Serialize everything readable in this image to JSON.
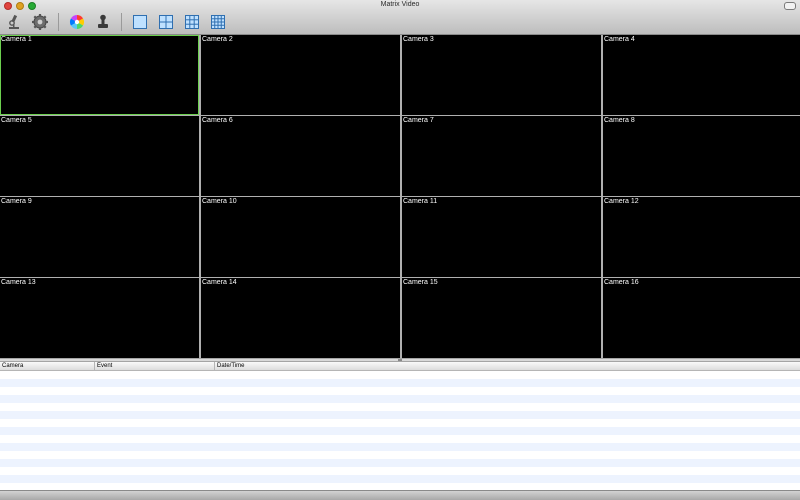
{
  "window": {
    "title": "Matrix Video"
  },
  "toolbar": {
    "items": [
      {
        "icon": "microscope-icon"
      },
      {
        "icon": "gear-icon"
      },
      {
        "icon": "color-wheel-icon"
      },
      {
        "icon": "stamp-icon"
      },
      {
        "icon": "layout-1x1-icon"
      },
      {
        "icon": "layout-2x2-icon"
      },
      {
        "icon": "layout-3x3-icon"
      },
      {
        "icon": "layout-4x4-icon"
      }
    ]
  },
  "cameras": [
    "Camera 1",
    "Camera 2",
    "Camera 3",
    "Camera 4",
    "Camera 5",
    "Camera 6",
    "Camera 7",
    "Camera 8",
    "Camera 9",
    "Camera 10",
    "Camera 11",
    "Camera 12",
    "Camera 13",
    "Camera 14",
    "Camera 15",
    "Camera 16"
  ],
  "selected_camera": "Camera 1",
  "events_table": {
    "columns": [
      "Camera",
      "Event",
      "Date/Time"
    ],
    "rows": []
  },
  "colors": {
    "selection": "#6cd04f",
    "row_stripe": "#edf3fe",
    "tile_bg": "#000000"
  }
}
